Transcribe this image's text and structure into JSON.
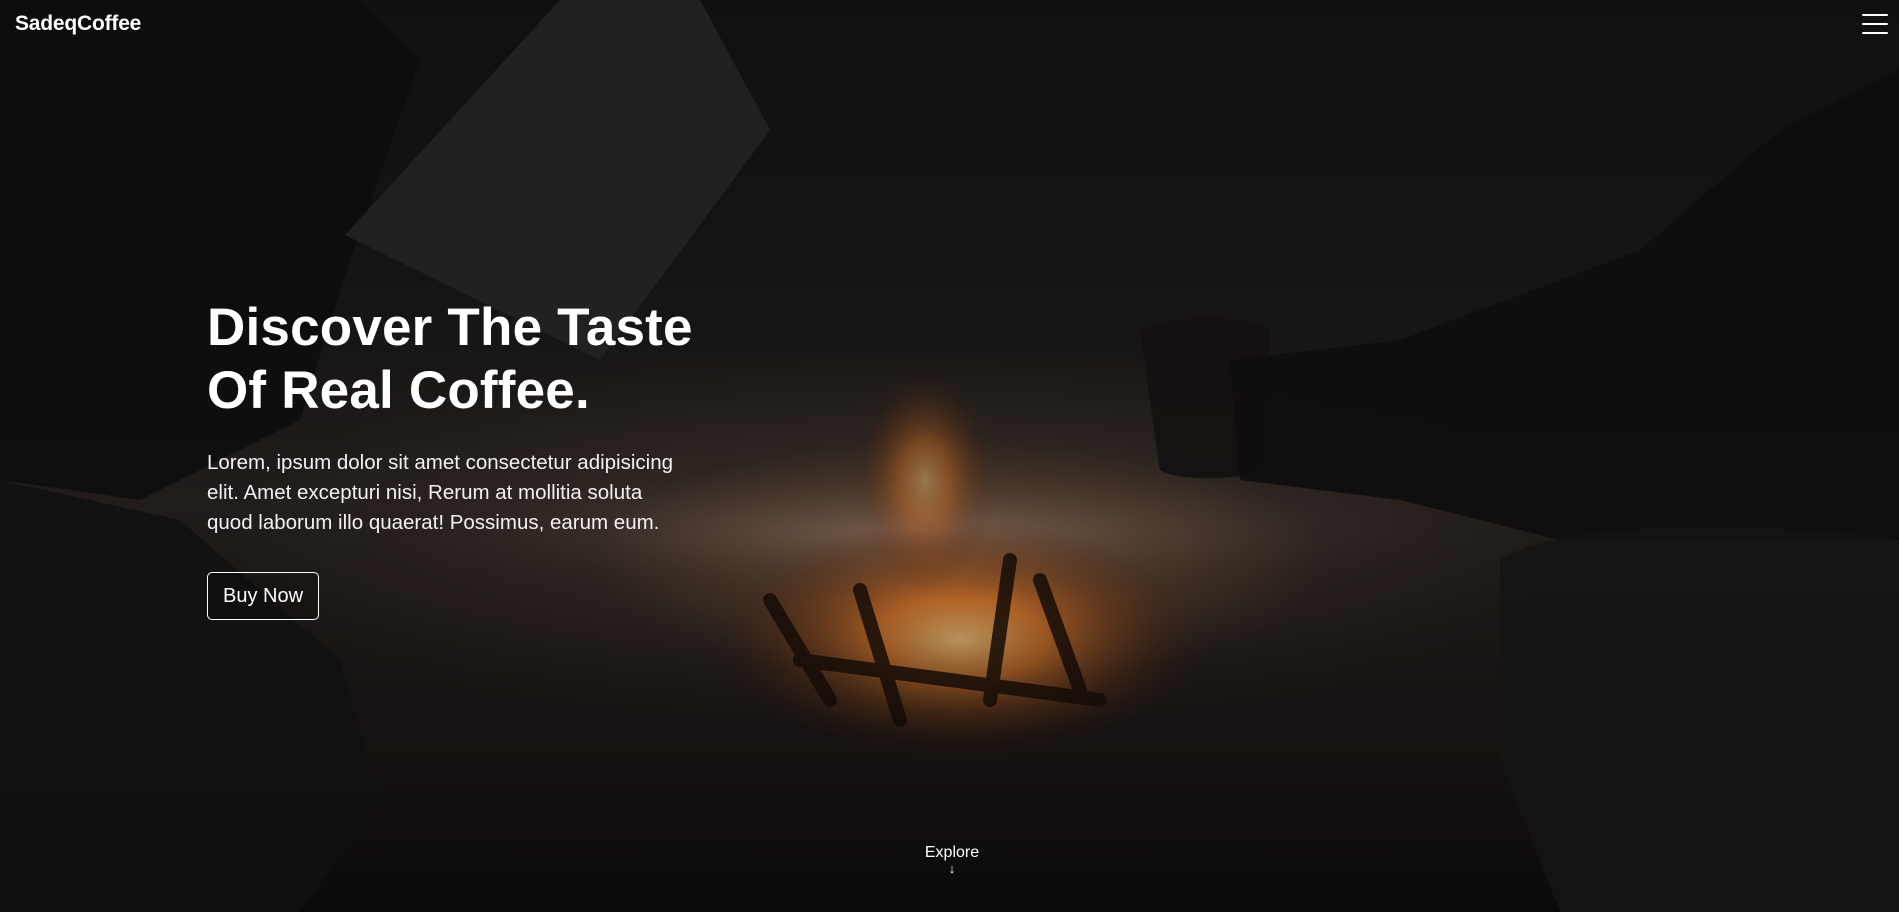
{
  "header": {
    "logo": "SadeqCoffee",
    "menu_icon": "hamburger-menu-icon"
  },
  "hero": {
    "title_line_1": "Discover The Taste",
    "title_line_2": "Of Real Coffee.",
    "description_line_1": "Lorem, ipsum dolor sit amet consectetur adipisicing",
    "description_line_2": "elit. Amet excepturi nisi, Rerum at mollitia soluta",
    "description_line_3": "quod laborum illo quaerat! Possimus, earum eum.",
    "cta_label": "Buy Now"
  },
  "explore": {
    "label": "Explore",
    "arrow": "↓",
    "arrow_icon": "arrow-down-icon"
  },
  "colors": {
    "text": "#ffffff",
    "background": "#0b0a0a",
    "fire_glow": "#ff9a45"
  }
}
